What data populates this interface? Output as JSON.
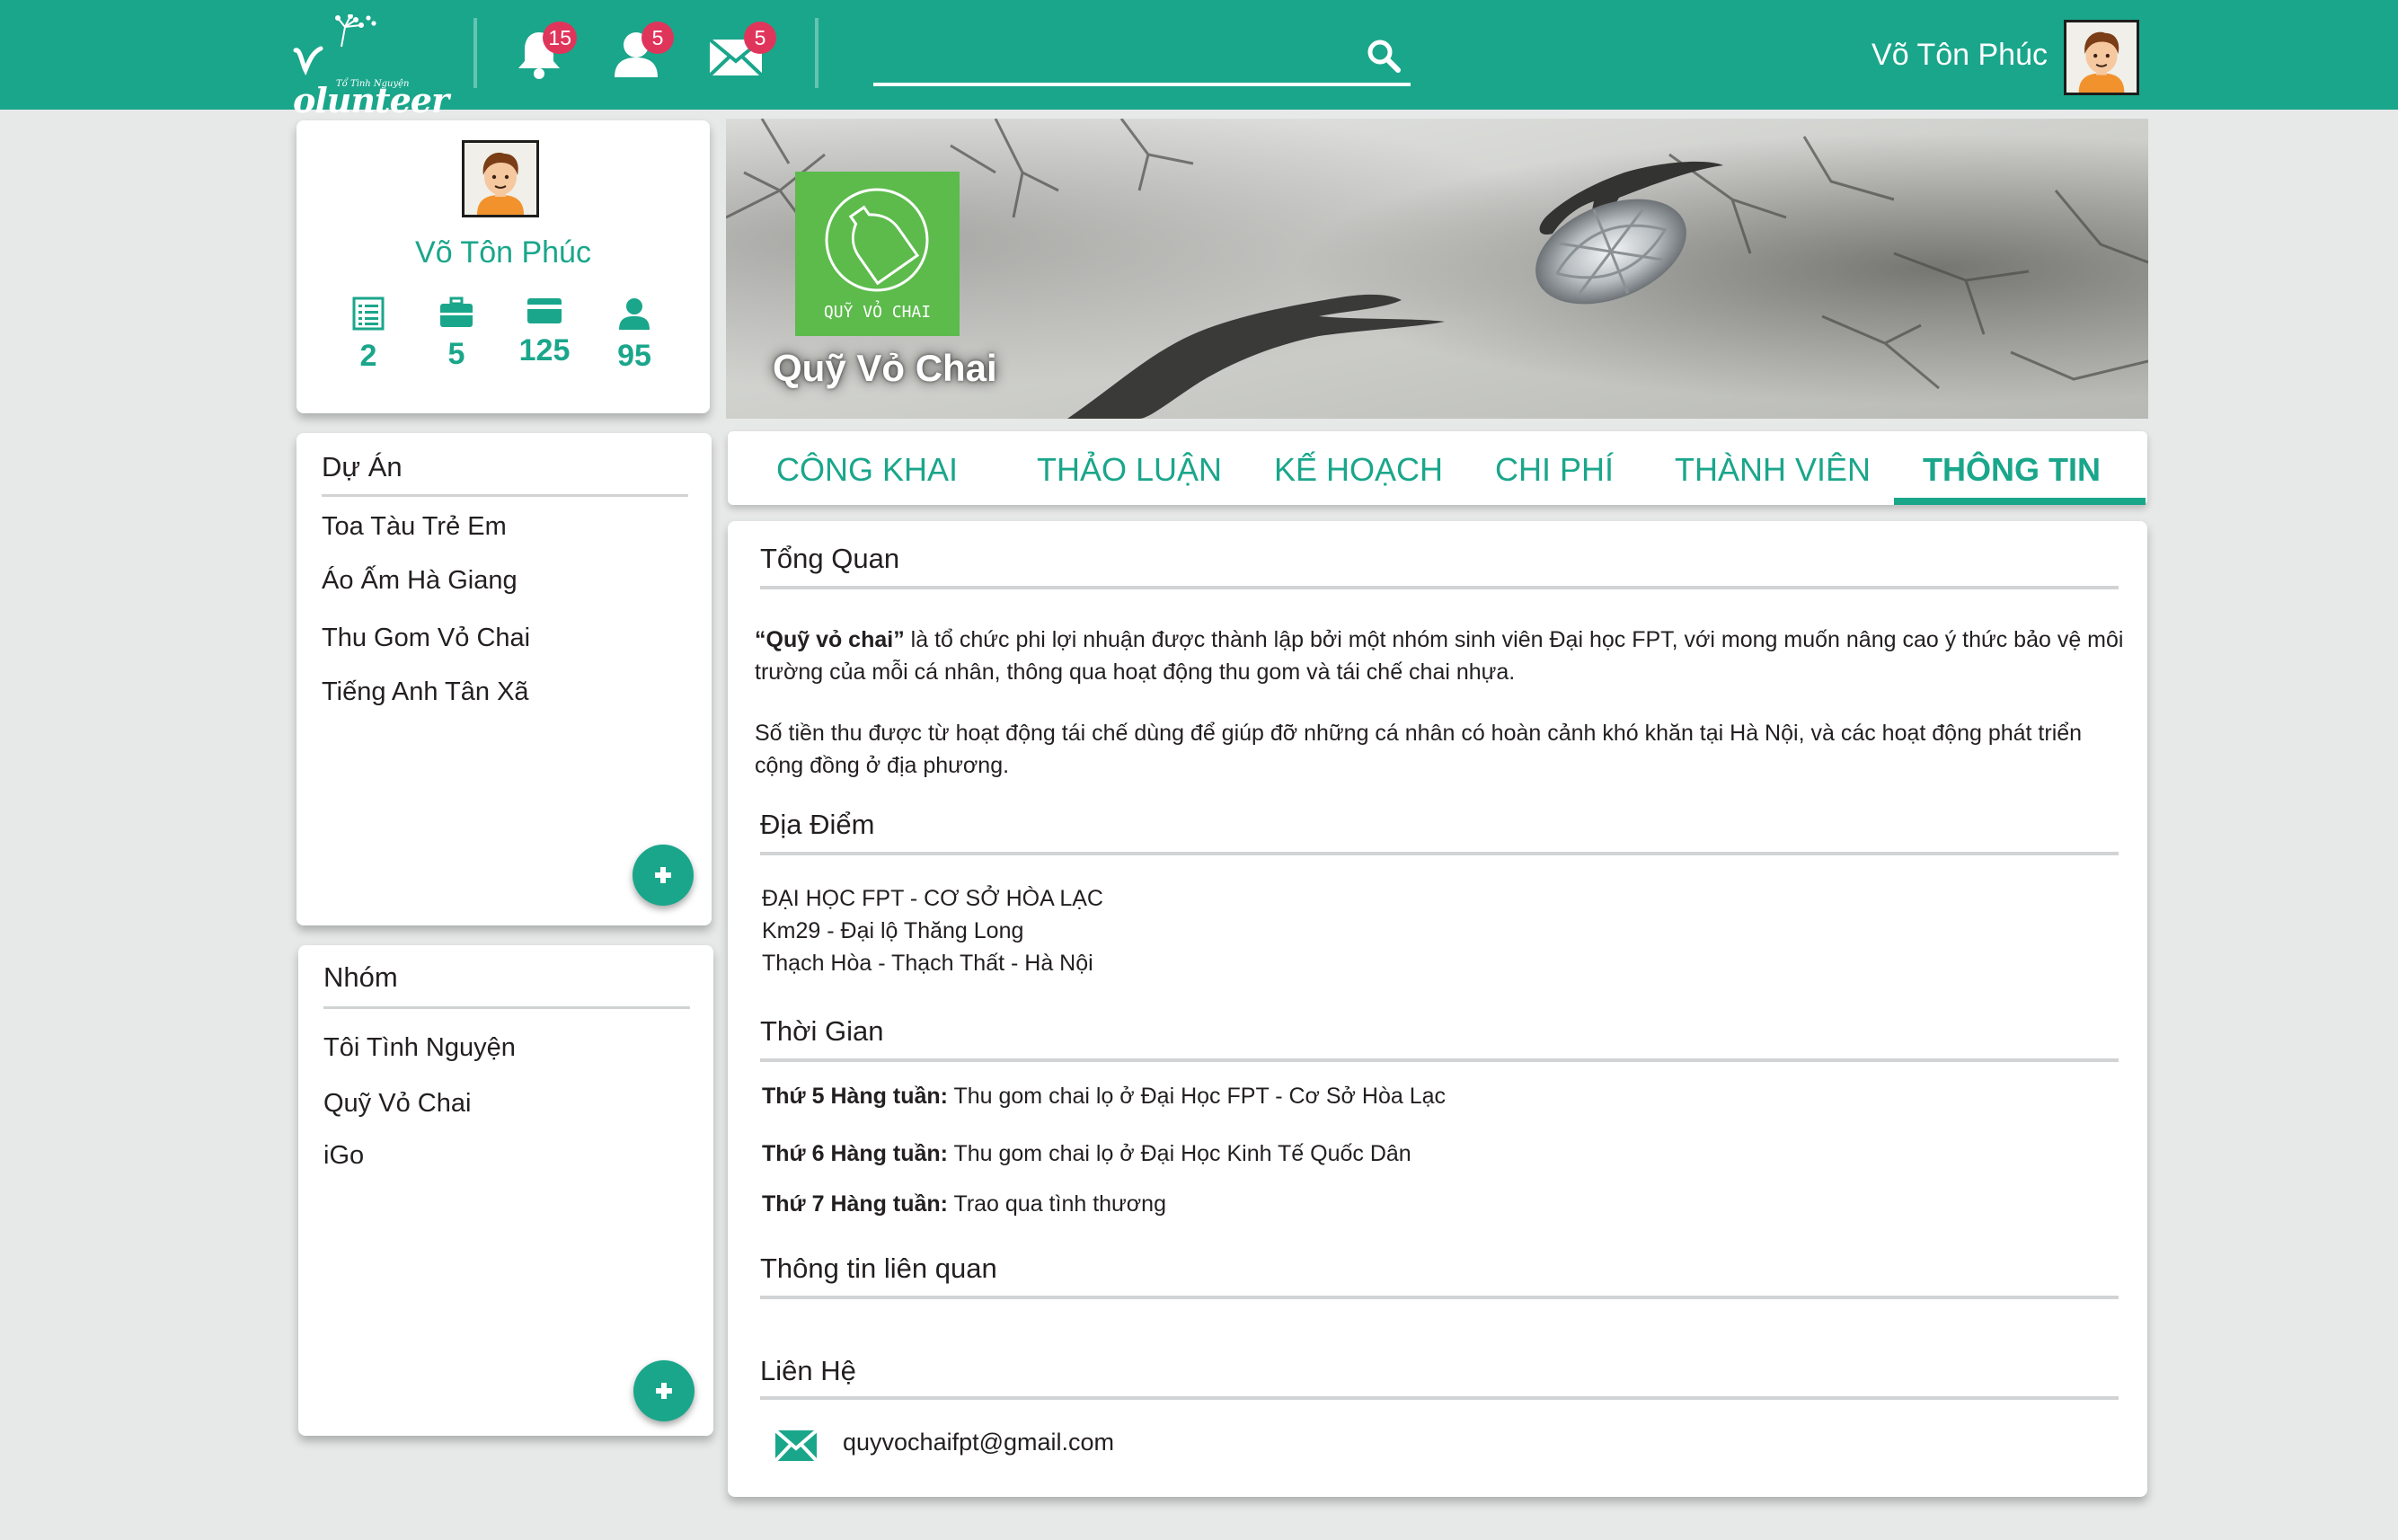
{
  "brand": {
    "logo_word": "olunteer",
    "logo_tagline": "Tổ Tình Nguyện"
  },
  "header": {
    "notifications_count": "15",
    "friend_requests_count": "5",
    "messages_count": "5",
    "search_placeholder": "",
    "user_name": "Võ Tôn Phúc"
  },
  "profile": {
    "name": "Võ Tôn Phúc",
    "stats": [
      {
        "icon": "list-icon",
        "value": "2"
      },
      {
        "icon": "briefcase-icon",
        "value": "5"
      },
      {
        "icon": "card-icon",
        "value": "125"
      },
      {
        "icon": "person-icon",
        "value": "95"
      }
    ]
  },
  "projects": {
    "title": "Dự Án",
    "items": [
      "Toa Tàu Trẻ Em",
      "Áo Ấm Hà Giang",
      "Thu Gom Vỏ Chai",
      "Tiếng Anh Tân Xã"
    ]
  },
  "groups": {
    "title": "Nhóm",
    "items": [
      "Tôi Tình Nguyện",
      "Quỹ Vỏ Chai",
      "iGo"
    ]
  },
  "banner": {
    "group_name": "Quỹ Vỏ Chai",
    "logo_label": "QUỸ VỎ CHAI"
  },
  "tabs": [
    "CÔNG KHAI",
    "THẢO LUẬN",
    "KẾ HOẠCH",
    "CHI PHÍ",
    "THÀNH VIÊN",
    "THÔNG TIN"
  ],
  "active_tab": "THÔNG TIN",
  "info": {
    "overview_title": "Tổng Quan",
    "overview_p1_bold": "“Quỹ vỏ chai”",
    "overview_p1": " là tổ chức phi lợi nhuận được thành lập bởi một nhóm sinh viên Đại học FPT, với mong muốn nâng cao ý thức bảo vệ môi trường của mỗi cá nhân, thông qua hoạt động thu gom và tái chế chai nhựa.",
    "overview_p2": "Số tiền thu được từ hoạt động tái chế dùng để giúp đỡ những cá nhân có hoàn cảnh khó khăn tại Hà Nội, và các hoạt động phát triển cộng đồng ở địa phương.",
    "location_title": "Địa Điểm",
    "location_lines": [
      "ĐẠI HỌC FPT - CƠ SỞ HÒA LẠC",
      "Km29 - Đại lộ Thăng Long",
      "Thạch Hòa - Thạch Thất - Hà Nội"
    ],
    "time_title": "Thời Gian",
    "schedule": [
      {
        "day": "Thứ 5 Hàng tuần:",
        "text": " Thu gom chai lọ ở Đại Học FPT - Cơ Sở Hòa Lạc"
      },
      {
        "day": "Thứ 6 Hàng tuần:",
        "text": " Thu gom chai lọ ở Đại Học Kinh Tế Quốc Dân"
      },
      {
        "day": "Thứ 7 Hàng tuần:",
        "text": " Trao qua tình thương"
      }
    ],
    "related_title": "Thông tin liên quan",
    "contact_title": "Liên Hệ",
    "email": "quyvochaifpt@gmail.com"
  },
  "colors": {
    "primary": "#1aa68b",
    "badge": "#e0355b",
    "page_bg": "#e7e8e8",
    "group_logo": "#5cbb4b"
  }
}
